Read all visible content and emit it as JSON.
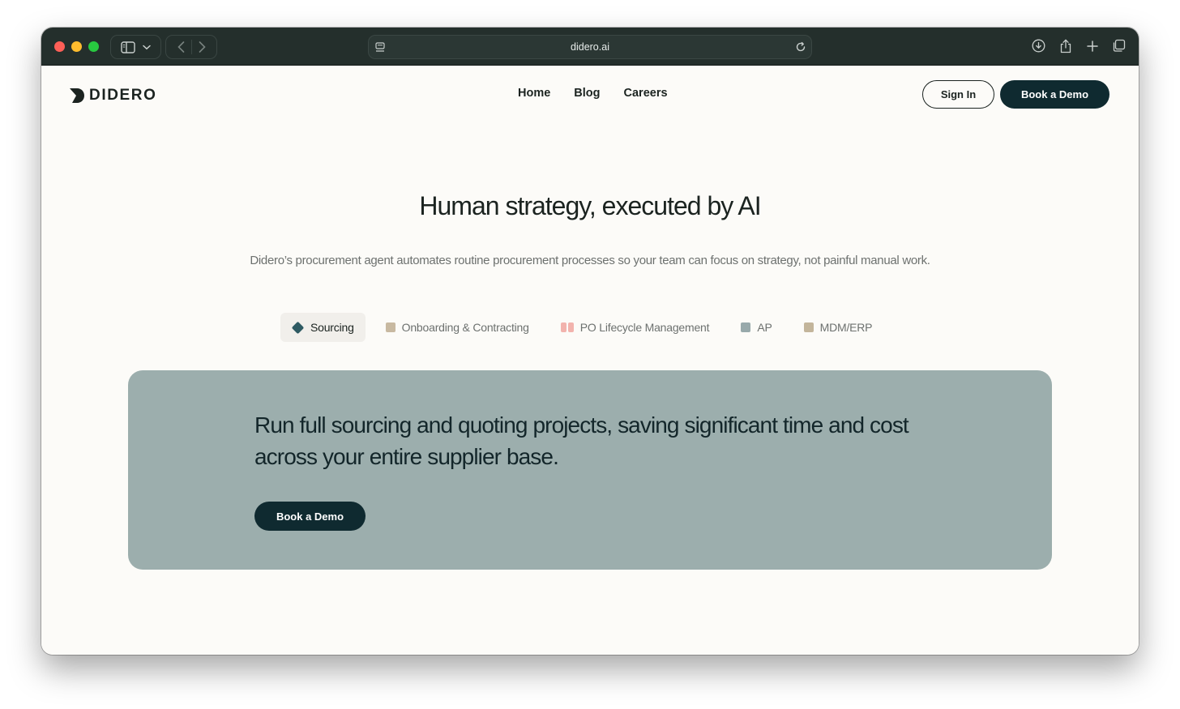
{
  "browser": {
    "url": "didero.ai"
  },
  "site": {
    "logo_text": "DIDERO",
    "nav": [
      "Home",
      "Blog",
      "Careers"
    ],
    "sign_in_label": "Sign In",
    "book_demo_label": "Book a Demo"
  },
  "hero": {
    "title": "Human strategy, executed by AI",
    "subtitle": "Didero’s procurement agent automates routine procurement processes so your team can focus on strategy, not painful manual work."
  },
  "tabs": [
    {
      "label": "Sourcing",
      "color": "#2e5a62",
      "active": true
    },
    {
      "label": "Onboarding & Contracting",
      "color": "#c8b9a1",
      "active": false
    },
    {
      "label": "PO Lifecycle Management",
      "color": "#f2b3ad",
      "active": false
    },
    {
      "label": "AP",
      "color": "#98a9ab",
      "active": false
    },
    {
      "label": "MDM/ERP",
      "color": "#c3b59b",
      "active": false
    }
  ],
  "feature": {
    "text": "Run full sourcing and quoting projects, saving significant time and cost across your entire supplier base.",
    "button_label": "Book a Demo"
  },
  "colors": {
    "brand_dark": "#0f2a30",
    "panel": "#9caead",
    "background": "#fcfbf8"
  }
}
